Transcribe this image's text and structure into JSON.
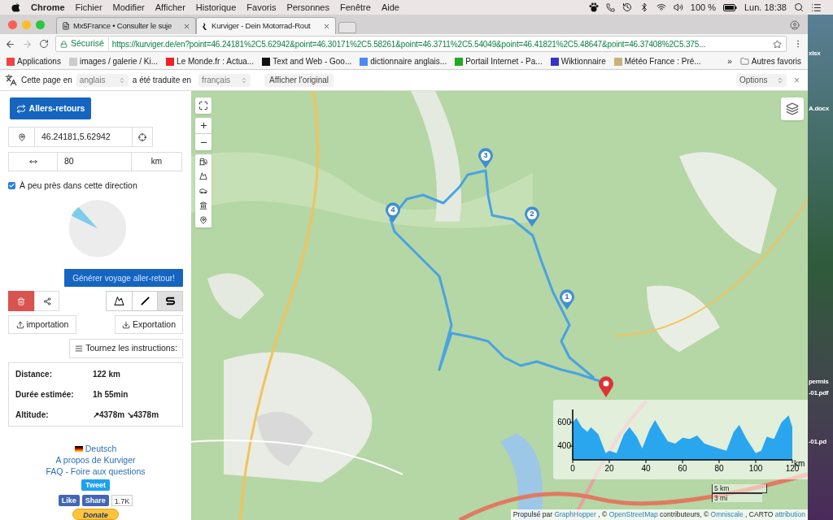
{
  "menu_bar": {
    "app": "Chrome",
    "items": [
      "Fichier",
      "Modifier",
      "Afficher",
      "Historique",
      "Favoris",
      "Personnes",
      "Fenêtre",
      "Aide"
    ],
    "battery": "100 %",
    "clock": "Lun. 18:38"
  },
  "tabs": [
    {
      "title": "Mx5France • Consulter le suje",
      "selected": false
    },
    {
      "title": "Kurviger - Dein Motorrad-Rout",
      "selected": true
    }
  ],
  "address_bar": {
    "security": "Sécurisé",
    "url": "https://kurviger.de/en?point=46.24181%2C5.62942&point=46.30171%2C5.58261&point=46.3711%2C5.54049&point=46.41821%2C5.48647&point=46.37408%2C5.375..."
  },
  "bookmarks": [
    "Applications",
    "images / galerie / Ki...",
    "Le Monde.fr : Actua...",
    "Text and Web - Goo...",
    "dictionnaire anglais...",
    "Portail Internet - Pa...",
    "Wiktionnaire",
    "Météo France : Pré..."
  ],
  "bookmarks_more": "»",
  "other_bookmarks": "Autres favoris",
  "translate_bar": {
    "label_1": "Cette page en",
    "source": "anglais",
    "label_2": "a été traduite en",
    "target": "français",
    "show_original": "Afficher l'original",
    "options": "Options",
    "close": "×"
  },
  "sidebar": {
    "round_trip_button": "Allers-retours",
    "location": "46.24181,5.62942",
    "distance": "80",
    "unit": "km",
    "direction": {
      "label": "À peu près dans cette direction",
      "checked": true
    },
    "generate_button": "Générer voyage aller-retour!",
    "modes": [
      {
        "selected": false
      },
      {
        "selected": false
      },
      {
        "selected": true
      }
    ],
    "import_button": "importation",
    "export_button": "Exportation",
    "instructions_button": "Tournez les instructions:",
    "stats": [
      {
        "label": "Distance:",
        "value": "122 km"
      },
      {
        "label": "Durée estimée:",
        "value": "1h 55min"
      },
      {
        "label": "Altitude:",
        "value": "↗4378m ↘4378m"
      }
    ],
    "links": [
      "Deutsch",
      "A propos de Kurviger",
      "FAQ - Foire aux questions"
    ],
    "tweet": "Tweet",
    "like": "Like",
    "share": "Share",
    "share_count": "1.7K",
    "donate": "Donate"
  },
  "map": {
    "waypoints": [
      "1",
      "2",
      "3",
      "4"
    ],
    "elevation": {
      "chart_data": {
        "type": "area",
        "x": [
          0,
          2,
          5,
          8,
          10,
          14,
          18,
          20,
          24,
          28,
          31,
          35,
          38,
          42,
          45,
          48,
          52,
          56,
          60,
          64,
          68,
          72,
          76,
          80,
          84,
          88,
          91,
          95,
          100,
          103,
          106,
          110,
          114,
          118,
          120
        ],
        "series": [
          {
            "color": "#2aa6ef",
            "values": [
              600,
              640,
              560,
              520,
              560,
              500,
              340,
              360,
              340,
              500,
              560,
              480,
              380,
              540,
              620,
              540,
              440,
              420,
              470,
              460,
              490,
              420,
              400,
              380,
              360,
              520,
              580,
              460,
              340,
              360,
              480,
              460,
              600,
              660,
              560
            ]
          }
        ],
        "xlim": [
          0,
          120
        ],
        "ylim": [
          283,
          710
        ],
        "xticks": [
          0,
          20,
          40,
          60,
          80,
          100,
          120
        ],
        "yticks": [
          400,
          600
        ],
        "xlabel": "km"
      }
    },
    "scale": [
      "5 km",
      "3 mi"
    ],
    "attribution": {
      "prefix": "Propulsé par",
      "graphhopper": "GraphHopper",
      "osm_prefix": ", ©",
      "osm": "OpenStreetMap",
      "osm_suffix": "contributeurs, ©",
      "omniscale": "Omniscale",
      "carto": ", CARTO",
      "attribution": "attribution"
    }
  },
  "desktop_files": [
    "xlsx",
    "A.docx",
    "permis",
    "-01.pdf",
    "-01.pd"
  ]
}
